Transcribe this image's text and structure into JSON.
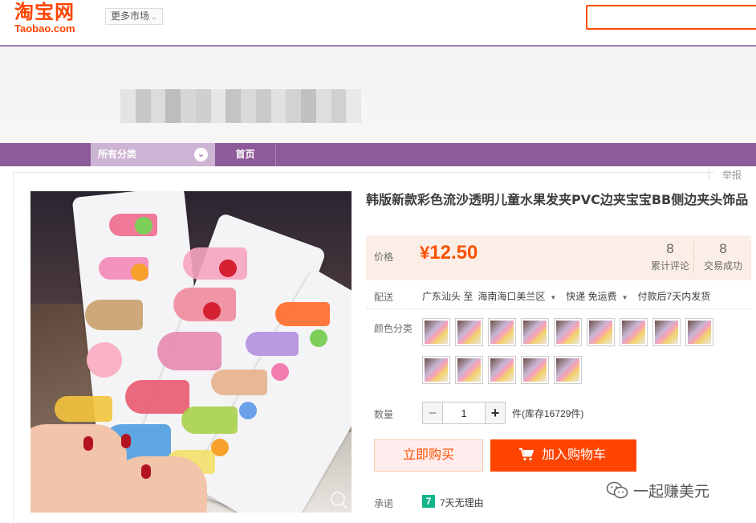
{
  "header": {
    "logo_cn": "淘宝网",
    "logo_en": "Taobao.com",
    "more_market": "更多市场",
    "search_placeholder": ""
  },
  "nav": {
    "all_categories": "所有分类",
    "home": "首页"
  },
  "report_label": "举报",
  "product": {
    "title": "韩版新款彩色流沙透明儿童水果发夹PVC边夹宝宝BB侧边夹头饰品",
    "price_label": "价格",
    "currency": "¥",
    "price": "12.50",
    "reviews_count": "8",
    "reviews_label": "累计评论",
    "sales_count": "8",
    "sales_label": "交易成功"
  },
  "delivery": {
    "label": "配送",
    "from": "广东汕头 至",
    "to": "海南海口美兰区",
    "shipping": "快递 免运费",
    "dispatch": "付款后7天内发货"
  },
  "colors": {
    "label": "颜色分类",
    "swatch_count": 14
  },
  "quantity": {
    "label": "数量",
    "value": "1",
    "minus": "−",
    "plus": "+",
    "stock_text": "件(库存16729件)"
  },
  "actions": {
    "buy_now": "立即购买",
    "add_to_cart": "加入购物车"
  },
  "promise": {
    "label": "承诺",
    "badge": "7",
    "text": "7天无理由"
  },
  "watermark": {
    "text": "一起赚美元"
  },
  "colors_palette": {
    "taobao_orange": "#ff4400",
    "nav_purple": "#8e5b9a",
    "price_bg": "#fbeee6",
    "promise_green": "#11b38b"
  }
}
